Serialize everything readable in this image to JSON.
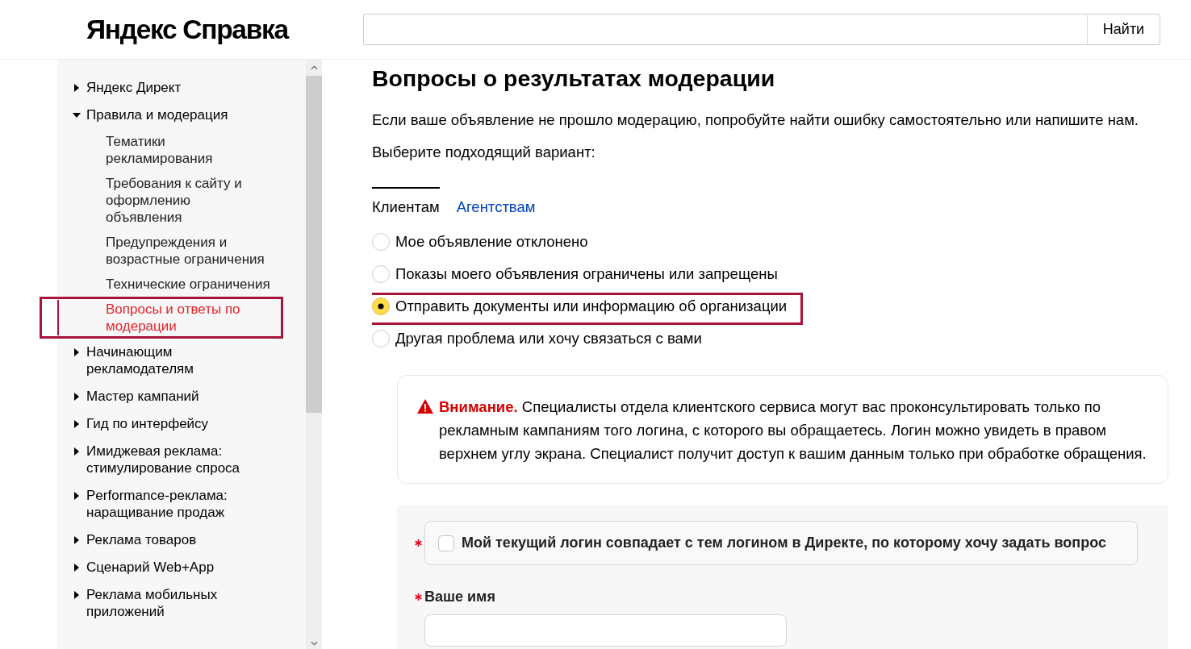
{
  "header": {
    "logo": "Яндекс Справка",
    "search_button": "Найти"
  },
  "sidebar": {
    "items": [
      {
        "label": "Яндекс Директ",
        "expanded": false,
        "selected": false,
        "highlighted": false
      },
      {
        "label": "Правила и модерация",
        "expanded": true,
        "selected": false,
        "highlighted": false,
        "children": [
          {
            "label": "Тематики рекламирования",
            "selected": false,
            "highlighted": false
          },
          {
            "label": "Требования к сайту и оформлению объявления",
            "selected": false,
            "highlighted": false
          },
          {
            "label": "Предупреждения и возрастные ограничения",
            "selected": false,
            "highlighted": false
          },
          {
            "label": "Технические ограничения",
            "selected": false,
            "highlighted": false
          },
          {
            "label": "Вопросы и ответы по модерации",
            "selected": true,
            "highlighted": true
          }
        ]
      },
      {
        "label": "Начинающим рекламодателям",
        "expanded": false,
        "selected": false,
        "highlighted": false
      },
      {
        "label": "Мастер кампаний",
        "expanded": false,
        "selected": false,
        "highlighted": false
      },
      {
        "label": "Гид по интерфейсу",
        "expanded": false,
        "selected": false,
        "highlighted": false
      },
      {
        "label": "Имиджевая реклама: стимулирование спроса",
        "expanded": false,
        "selected": false,
        "highlighted": false
      },
      {
        "label": "Performance-реклама: наращивание продаж",
        "expanded": false,
        "selected": false,
        "highlighted": false
      },
      {
        "label": "Реклама товаров",
        "expanded": false,
        "selected": false,
        "highlighted": false
      },
      {
        "label": "Сценарий Web+App",
        "expanded": false,
        "selected": false,
        "highlighted": false
      },
      {
        "label": "Реклама мобильных приложений",
        "expanded": false,
        "selected": false,
        "highlighted": false
      }
    ]
  },
  "article": {
    "title": "Вопросы о результатах модерации",
    "intro": "Если ваше объявление не прошло модерацию, попробуйте найти ошибку самостоятельно или напишите нам.",
    "prompt": "Выберите подходящий вариант:",
    "tabs": [
      {
        "label": "Клиентам",
        "selected": true
      },
      {
        "label": "Агентствам",
        "selected": false
      }
    ],
    "options": [
      {
        "label": "Мое объявление отклонено",
        "selected": false,
        "highlighted": false
      },
      {
        "label": "Показы моего объявления ограничены или запрещены",
        "selected": false,
        "highlighted": false
      },
      {
        "label": "Отправить документы или информацию об организации",
        "selected": true,
        "highlighted": true
      },
      {
        "label": "Другая проблема или хочу связаться с вами",
        "selected": false,
        "highlighted": false
      }
    ],
    "notice": {
      "text": "**Внимание.** Специалисты отдела клиентского сервиса могут вас проконсультировать только по рекламным кампаниям того логина, с которого вы обращаетесь. Логин можно увидеть в правом верхнем углу экрана. Специалист получит доступ к вашим данным только при обработке обращения."
    },
    "form": {
      "fields": [
        {
          "kind": "checkbox",
          "label": "Мой текущий логин совпадает с тем логином в Директе, по которому хочу задать вопрос",
          "required": true,
          "checked": false
        },
        {
          "kind": "text",
          "label": "Ваше имя",
          "required": true
        }
      ]
    }
  }
}
